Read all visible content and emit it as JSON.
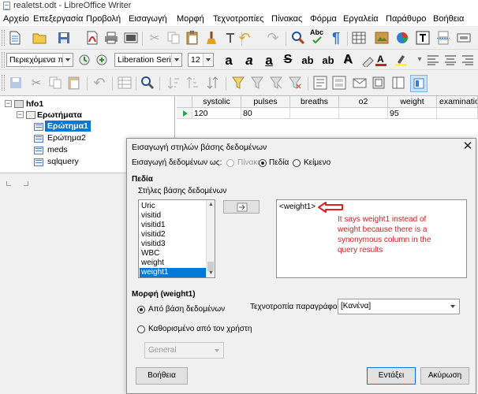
{
  "window": {
    "title": "realetst.odt - LibreOffice Writer"
  },
  "menu": [
    "Αρχείο",
    "Επεξεργασία",
    "Προβολή",
    "Εισαγωγή",
    "Μορφή",
    "Τεχνοτροπίες",
    "Πίνακας",
    "Φόρμα",
    "Εργαλεία",
    "Παράθυρο",
    "Βοήθεια"
  ],
  "formatting": {
    "paragraph_style": "Περιεχόμενα πίνα",
    "font_name": "Liberation Serif",
    "font_size": "12"
  },
  "toolbar_glyphs": {
    "bold": "a",
    "italic": "a",
    "underline": "a",
    "strike": "S",
    "superscript": "ab",
    "subscript": "ab",
    "shadow": "A",
    "spell": "Abc"
  },
  "tree": {
    "database": "hfo1",
    "folder": "Ερωτήματα",
    "items": [
      "Ερώτημα1",
      "Ερώτημα2",
      "meds",
      "sqlquery"
    ],
    "selected": "Ερώτημα1"
  },
  "grid": {
    "columns": [
      "systolic",
      "pulses",
      "breaths",
      "o2",
      "weight",
      "examination"
    ],
    "row": [
      "120",
      "80",
      "",
      "",
      "95",
      ""
    ]
  },
  "dialog": {
    "title": "Εισαγωγή στηλών βάσης δεδομένων",
    "insert_as_label": "Εισαγωγή δεδομένων ως:",
    "insert_options": [
      "Πίνακας",
      "Πεδία",
      "Κείμενο"
    ],
    "fields_section": "Πεδία",
    "columns_label": "Στήλες βάσης δεδομένων",
    "column_list": [
      "Uric",
      "visitid",
      "visitid1",
      "visitid2",
      "visitid3",
      "WBC",
      "weight",
      "weight1"
    ],
    "selected_column": "weight1",
    "text_content": "<weight1>",
    "annotation": "It says weight1 instead of weight because there is a synonymous column in the query results",
    "format_section": "Μορφή (weight1)",
    "format_options": [
      "Από βάση δεδομένων",
      "Καθορισμένο από τον χρήστη"
    ],
    "format_value": "General",
    "paragraph_style_label": "Τεχνοτροπία παραγράφου:",
    "paragraph_style_value": "[Κανένα]",
    "buttons": {
      "help": "Βοήθεια",
      "ok": "Εντάξει",
      "cancel": "Ακύρωση"
    }
  },
  "colors": {
    "selection": "#0078d7",
    "annotation": "#d32222",
    "arrow": "#e02020"
  }
}
